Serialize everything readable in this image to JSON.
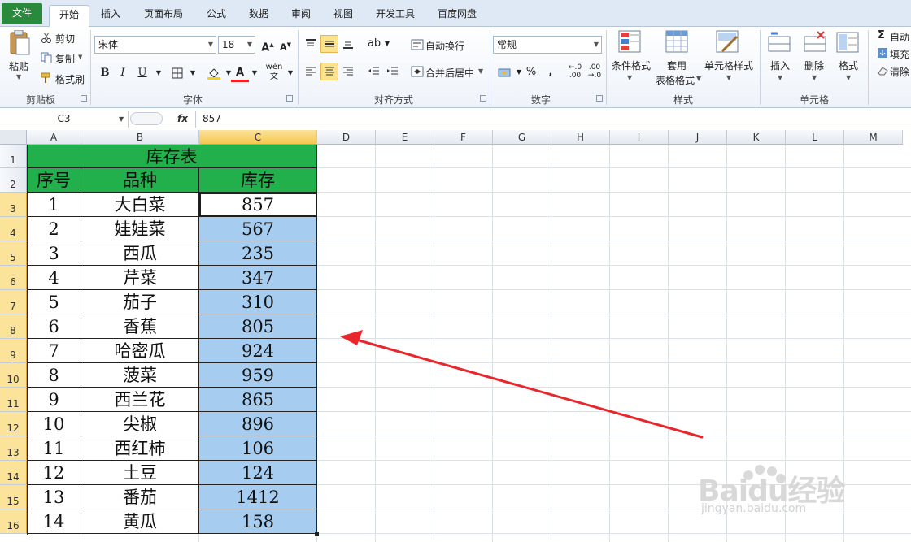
{
  "ribbon": {
    "tabs": [
      "文件",
      "开始",
      "插入",
      "页面布局",
      "公式",
      "数据",
      "审阅",
      "视图",
      "开发工具",
      "百度网盘"
    ],
    "clipboard": {
      "paste": "粘贴",
      "cut": "剪切",
      "copy": "复制",
      "format_painter": "格式刷",
      "group": "剪贴板"
    },
    "font": {
      "name": "宋体",
      "size": "18",
      "group": "字体"
    },
    "alignment": {
      "wrap": "自动换行",
      "merge": "合并后居中",
      "group": "对齐方式"
    },
    "number": {
      "format": "常规",
      "group": "数字"
    },
    "styles": {
      "conditional": "条件格式",
      "table_l1": "套用",
      "table_l2": "表格格式",
      "cell_styles": "单元格样式",
      "group": "样式"
    },
    "cells": {
      "insert": "插入",
      "delete": "删除",
      "format": "格式",
      "group": "单元格"
    },
    "editing": {
      "autosum": "自动",
      "fill": "填充",
      "clear": "清除"
    }
  },
  "formula": {
    "namebox": "C3",
    "fx": "fx",
    "value": "857"
  },
  "sheet": {
    "columns": [
      "A",
      "B",
      "C",
      "D",
      "E",
      "F",
      "G",
      "H",
      "I",
      "J",
      "K",
      "L",
      "M"
    ],
    "rows": [
      "1",
      "2",
      "3",
      "4",
      "5",
      "6",
      "7",
      "8",
      "9",
      "10",
      "11",
      "12",
      "13",
      "14",
      "15",
      "16"
    ],
    "title": "库存表",
    "headers": [
      "序号",
      "品种",
      "库存"
    ],
    "data": [
      [
        "1",
        "大白菜",
        "857"
      ],
      [
        "2",
        "娃娃菜",
        "567"
      ],
      [
        "3",
        "西瓜",
        "235"
      ],
      [
        "4",
        "芹菜",
        "347"
      ],
      [
        "5",
        "茄子",
        "310"
      ],
      [
        "6",
        "香蕉",
        "805"
      ],
      [
        "7",
        "哈密瓜",
        "924"
      ],
      [
        "8",
        "菠菜",
        "959"
      ],
      [
        "9",
        "西兰花",
        "865"
      ],
      [
        "10",
        "尖椒",
        "896"
      ],
      [
        "11",
        "西红柿",
        "106"
      ],
      [
        "12",
        "土豆",
        "124"
      ],
      [
        "13",
        "番茄",
        "1412"
      ],
      [
        "14",
        "黄瓜",
        "158"
      ]
    ]
  },
  "watermark": {
    "brand": "Baidu经验",
    "url": "jingyan.baidu.com"
  },
  "colors": {
    "header_green": "#21b04b",
    "selection_blue": "#a6cdf0",
    "arrow_red": "#e8262b",
    "file_tab": "#2a8a3c"
  }
}
